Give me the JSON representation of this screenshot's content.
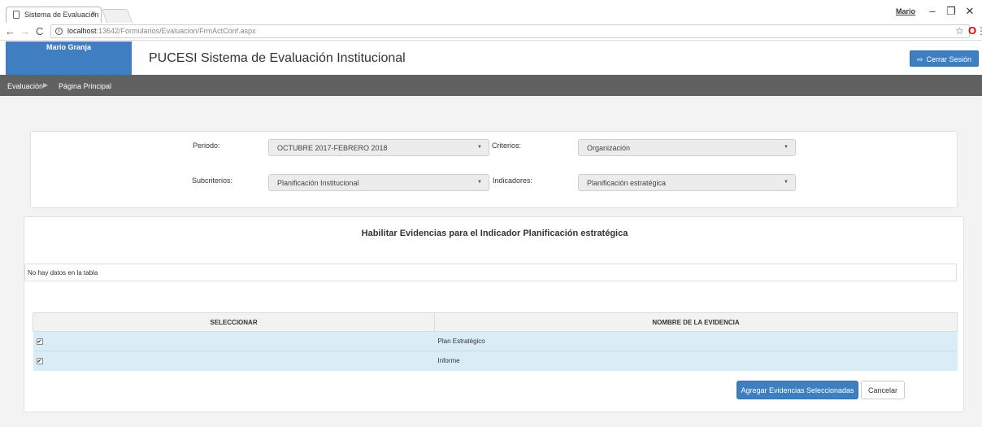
{
  "browser": {
    "tab_title": "Sistema de Evaluación In",
    "tab_close": "×",
    "url_host": "localhost",
    "url_path": ":13642/Formularios/Evaluacion/FrmActConf.aspx",
    "window_user": "Mario",
    "icons": [
      "document-icon",
      "back-arrow-icon",
      "forward-arrow-icon",
      "reload-icon",
      "info-icon",
      "star-icon",
      "opera-icon",
      "menu-icon"
    ]
  },
  "header": {
    "user_name": "Mario Granja",
    "app_title": "PUCESI Sistema de Evaluación Institucional",
    "logout_label": "Cerrar Sesión"
  },
  "nav": {
    "crumb1": "Evaluación",
    "crumb2": "Página Principal"
  },
  "filters": {
    "periodo_label": "Periodo:",
    "periodo_value": "OCTUBRE 2017-FEBRERO 2018",
    "criterios_label": "Criterios:",
    "criterios_value": "Organización",
    "subcriterios_label": "Subcriterios:",
    "subcriterios_value": "Planificación Institucional",
    "indicadores_label": "Indicadores:",
    "indicadores_value": "Planificación estratégica"
  },
  "main": {
    "title": "Habilitar Evidencias para el Indicador Planificación estratégica",
    "empty_message": "No hay datos en la tabla",
    "columns": [
      "SELECCIONAR",
      "NOMBRE DE LA EVIDENCIA"
    ],
    "rows": [
      {
        "checked": true,
        "name": "Plan Estratégico"
      },
      {
        "checked": true,
        "name": "Informe"
      }
    ],
    "add_label": "Agregar Evidencias Seleccionadas",
    "cancel_label": "Cancelar"
  },
  "colors": {
    "primary": "#3e7fc2",
    "nav_bg": "#616161",
    "row_bg": "#d9edf7"
  }
}
